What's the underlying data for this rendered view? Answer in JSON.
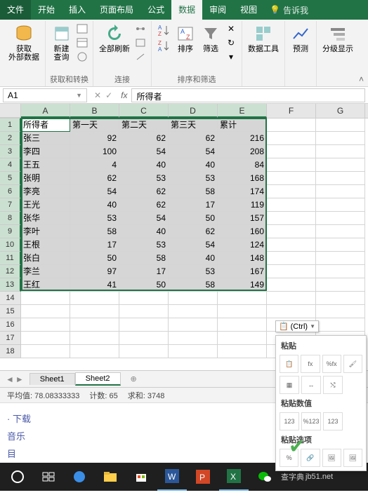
{
  "tabs": {
    "file": "文件",
    "home": "开始",
    "insert": "插入",
    "layout": "页面布局",
    "formulas": "公式",
    "data": "数据",
    "review": "审阅",
    "view": "视图",
    "tellme": "告诉我"
  },
  "ribbon": {
    "get_external": "获取\n外部数据",
    "new_query": "新建\n查询",
    "refresh_all": "全部刷新",
    "sort_az": "排序",
    "filter": "筛选",
    "data_tools": "数据工具",
    "forecast": "预测",
    "outline": "分级显示",
    "group_get": "获取和转换",
    "group_conn": "连接",
    "group_sort": "排序和筛选"
  },
  "namebox": "A1",
  "formula_value": "所得者",
  "columns": [
    "A",
    "B",
    "C",
    "D",
    "E",
    "F",
    "G"
  ],
  "headers": [
    "所得者",
    "第一天",
    "第二天",
    "第三天",
    "累计"
  ],
  "rows": [
    [
      "张三",
      92,
      62,
      62,
      216
    ],
    [
      "李四",
      100,
      54,
      54,
      208
    ],
    [
      "王五",
      4,
      40,
      40,
      84
    ],
    [
      "张明",
      62,
      53,
      53,
      168
    ],
    [
      "李亮",
      54,
      62,
      58,
      174
    ],
    [
      "王光",
      40,
      62,
      17,
      119
    ],
    [
      "张华",
      53,
      54,
      50,
      157
    ],
    [
      "李叶",
      58,
      40,
      62,
      160
    ],
    [
      "王根",
      17,
      53,
      54,
      124
    ],
    [
      "张白",
      50,
      58,
      40,
      148
    ],
    [
      "李兰",
      97,
      17,
      53,
      167
    ],
    [
      "王红",
      41,
      50,
      58,
      149
    ]
  ],
  "paste_smart_label": "(Ctrl)",
  "paste_menu": {
    "paste": "粘贴",
    "paste_values": "粘贴数值",
    "paste_options": "粘贴选项"
  },
  "sheets": {
    "s1": "Sheet1",
    "s2": "Sheet2"
  },
  "status": {
    "avg_label": "平均值:",
    "avg": "78.08333333",
    "count_label": "计数:",
    "count": "65",
    "sum_label": "求和:",
    "sum": "3748"
  },
  "browser": {
    "download": "下载",
    "music": "音乐",
    "item": "目"
  },
  "watermark": {
    "site1": "查字典",
    "site2": "jb51.net"
  }
}
